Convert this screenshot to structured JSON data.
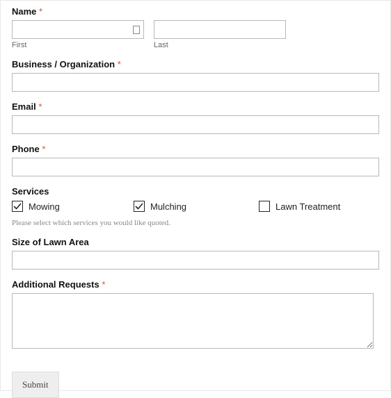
{
  "name": {
    "label": "Name",
    "required": true,
    "first": {
      "value": "",
      "sublabel": "First"
    },
    "last": {
      "value": "",
      "sublabel": "Last"
    }
  },
  "business": {
    "label": "Business / Organization",
    "required": true,
    "value": ""
  },
  "email": {
    "label": "Email",
    "required": true,
    "value": ""
  },
  "phone": {
    "label": "Phone",
    "required": true,
    "value": ""
  },
  "services": {
    "label": "Services",
    "options": [
      {
        "label": "Mowing",
        "checked": true
      },
      {
        "label": "Mulching",
        "checked": true
      },
      {
        "label": "Lawn Treatment",
        "checked": false
      }
    ],
    "hint": "Please select which services you would like quoted."
  },
  "lawn_size": {
    "label": "Size of Lawn Area",
    "required": false,
    "value": ""
  },
  "additional": {
    "label": "Additional Requests",
    "required": true,
    "value": ""
  },
  "submit_label": "Submit",
  "required_marker": "*"
}
